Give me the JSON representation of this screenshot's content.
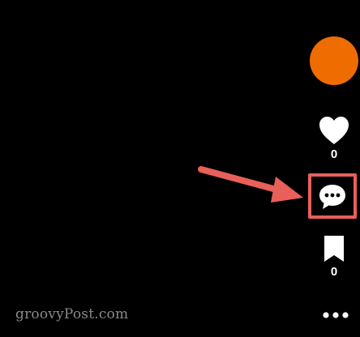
{
  "sidebar": {
    "avatar_color": "#ef6c00",
    "like": {
      "icon": "heart-icon",
      "count": "0"
    },
    "comment": {
      "icon": "comment-bubble-icon"
    },
    "bookmark": {
      "icon": "bookmark-icon",
      "count": "0"
    },
    "more": {
      "icon": "more-dots-icon"
    }
  },
  "annotation": {
    "color": "#e9605a",
    "arrow_icon": "arrow-right-icon"
  },
  "watermark": {
    "text": "groovyPost.com"
  }
}
